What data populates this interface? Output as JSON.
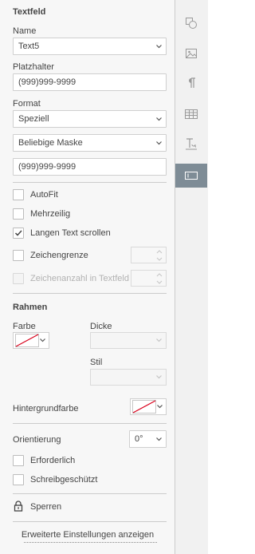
{
  "panel": {
    "title": "Textfeld",
    "name": {
      "label": "Name",
      "value": "Text5"
    },
    "placeholder": {
      "label": "Platzhalter",
      "value": "(999)999-9999"
    },
    "format": {
      "label": "Format",
      "value": "Speziell",
      "mask_value": "Beliebige Maske",
      "mask_text": "(999)999-9999"
    },
    "checkboxes": {
      "autofit": {
        "label": "AutoFit",
        "checked": false
      },
      "multiline": {
        "label": "Mehrzeilig",
        "checked": false
      },
      "scroll": {
        "label": "Langen Text scrollen",
        "checked": true
      },
      "charlimit": {
        "label": "Zeichengrenze",
        "checked": false
      },
      "comb": {
        "label": "Zeichenanzahl in Textfeld",
        "checked": false,
        "disabled": true
      }
    },
    "frame": {
      "title": "Rahmen",
      "color_label": "Farbe",
      "width_label": "Dicke",
      "style_label": "Stil"
    },
    "background": {
      "label": "Hintergrundfarbe"
    },
    "orientation": {
      "label": "Orientierung",
      "value": "0°"
    },
    "required": {
      "label": "Erforderlich",
      "checked": false
    },
    "readonly": {
      "label": "Schreibgeschützt",
      "checked": false
    },
    "lock": {
      "label": "Sperren"
    },
    "advanced_link": "Erweiterte Einstellungen anzeigen"
  },
  "rail": {
    "items": [
      {
        "name": "shape-settings-icon",
        "active": false
      },
      {
        "name": "image-settings-icon",
        "active": false
      },
      {
        "name": "paragraph-settings-icon",
        "active": false
      },
      {
        "name": "table-settings-icon",
        "active": false
      },
      {
        "name": "text-art-settings-icon",
        "active": false
      },
      {
        "name": "form-field-settings-icon",
        "active": true
      }
    ]
  },
  "colors": {
    "panel_bg": "#f7f7f7",
    "rail_active": "#7e8c96",
    "no_color_line": "#d9001b"
  }
}
